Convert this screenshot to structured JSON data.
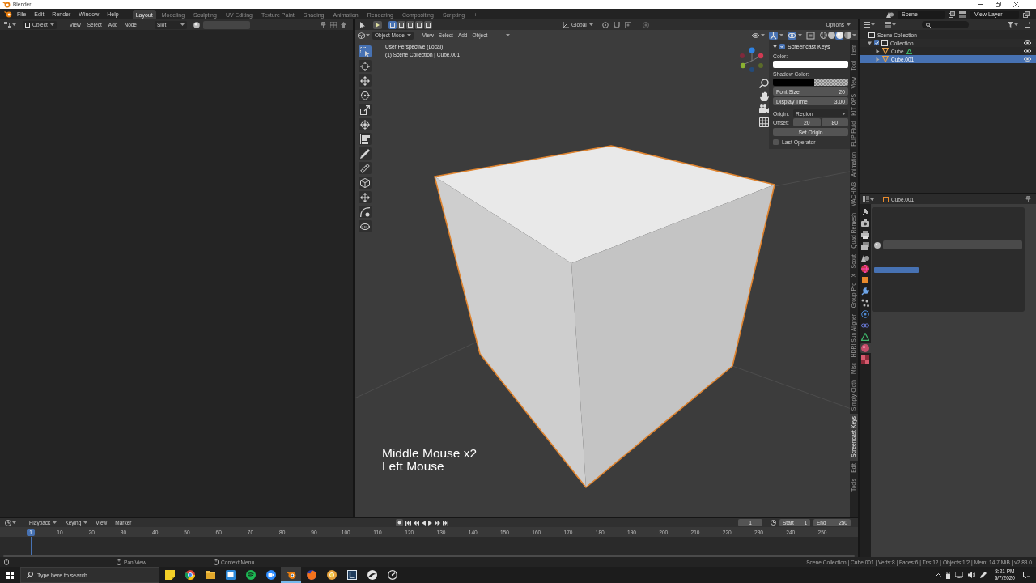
{
  "window": {
    "title": "Blender"
  },
  "menu": [
    "File",
    "Edit",
    "Render",
    "Window",
    "Help"
  ],
  "workspaces": [
    {
      "label": "Layout",
      "selected": true
    },
    {
      "label": "Modeling",
      "selected": false
    },
    {
      "label": "Sculpting",
      "selected": false
    },
    {
      "label": "UV Editing",
      "selected": false
    },
    {
      "label": "Texture Paint",
      "selected": false
    },
    {
      "label": "Shading",
      "selected": false
    },
    {
      "label": "Animation",
      "selected": false
    },
    {
      "label": "Rendering",
      "selected": false
    },
    {
      "label": "Compositing",
      "selected": false
    },
    {
      "label": "Scripting",
      "selected": false
    }
  ],
  "add_workspace": "+",
  "scene": {
    "scene": "Scene",
    "view_layer": "View Layer"
  },
  "node_editor": {
    "object_menu": "Object",
    "menus": [
      "View",
      "Select",
      "Add",
      "Node"
    ],
    "slot": "Slot"
  },
  "viewport": {
    "select_modes": [
      {
        "selected": true
      },
      {
        "selected": false
      },
      {
        "selected": false
      },
      {
        "selected": false
      },
      {
        "selected": false
      }
    ],
    "orientation": "Global",
    "options": "Options",
    "mode": "Object Mode",
    "menus": [
      "View",
      "Select",
      "Add",
      "Object"
    ],
    "toggles": [
      {
        "kind": "gizmo",
        "on": true
      },
      {
        "kind": "overlay",
        "on": true
      },
      {
        "kind": "xray",
        "on": false
      }
    ],
    "shading": [
      {
        "kind": "wireframe",
        "selected": false
      },
      {
        "kind": "solid",
        "selected": false
      },
      {
        "kind": "material",
        "selected": true
      },
      {
        "kind": "rendered",
        "selected": false
      }
    ],
    "tools": [
      {
        "kind": "select",
        "selected": true
      },
      {
        "kind": "cursor",
        "selected": false
      },
      {
        "kind": "move",
        "selected": false
      },
      {
        "kind": "rotate",
        "selected": false
      },
      {
        "kind": "scale",
        "selected": false
      },
      {
        "kind": "transform",
        "selected": false
      },
      {
        "kind": "align",
        "selected": false
      },
      {
        "kind": "annotate",
        "selected": false
      },
      {
        "kind": "measure",
        "selected": false
      },
      {
        "kind": "cube",
        "selected": false
      },
      {
        "kind": "move",
        "selected": false
      },
      {
        "kind": "bend",
        "selected": false
      },
      {
        "kind": "loop",
        "selected": false
      }
    ],
    "view_name": "User Perspective (Local)",
    "collection_info": "(1) Scene Collection | Cube.001",
    "keys": [
      "Middle Mouse x2",
      "Left Mouse"
    ]
  },
  "sidebar": {
    "panel": {
      "title": "Screencast Keys",
      "expanded": true,
      "enabled": true
    },
    "rows": [
      {
        "kind": "color",
        "label": "Color:",
        "color": "#ffffff"
      },
      {
        "kind": "color",
        "label": "Shadow Color:",
        "color": "#000000",
        "alpha": true
      },
      {
        "kind": "number",
        "label": "Font Size",
        "value": "20"
      },
      {
        "kind": "number",
        "label": "Display Time",
        "value": "3.00"
      },
      {
        "kind": "enum",
        "label": "Origin:",
        "value": "Region"
      },
      {
        "kind": "vector",
        "label": "Offset:",
        "values": [
          "20",
          "80"
        ]
      },
      {
        "kind": "button",
        "label": "Set Origin"
      },
      {
        "kind": "checkbox",
        "label": "Last Operator",
        "checked": false
      }
    ],
    "tabs": [
      {
        "label": "Item",
        "selected": false
      },
      {
        "label": "Tool",
        "selected": false
      },
      {
        "label": "View",
        "selected": false
      },
      {
        "label": "KIT OPS",
        "selected": false
      },
      {
        "label": "FLIP Fluid",
        "selected": false
      },
      {
        "label": "Animation",
        "selected": false
      },
      {
        "label": "MACHIN3",
        "selected": false
      },
      {
        "label": "Quad Remesh",
        "selected": false
      },
      {
        "label": "Scout",
        "selected": false
      },
      {
        "label": "X",
        "selected": false
      },
      {
        "label": "Group Pro",
        "selected": false
      },
      {
        "label": "HDRI Sun Aligner",
        "selected": false
      },
      {
        "label": "Misc",
        "selected": false
      },
      {
        "label": "Simply Cloth",
        "selected": false
      },
      {
        "label": "Screencast Keys",
        "selected": true
      },
      {
        "label": "Edit",
        "selected": false
      },
      {
        "label": "Tools",
        "selected": false
      }
    ]
  },
  "outliner": {
    "tree": [
      {
        "label": "Scene Collection",
        "kind": "scene",
        "selected": false,
        "children": [
          {
            "label": "Collection",
            "kind": "collection",
            "selected": false,
            "expanded": true,
            "checked": true,
            "visible": true,
            "children": [
              {
                "label": "Cube",
                "kind": "mesh",
                "selected": false,
                "expanded": false,
                "visible": true,
                "has_data": true
              },
              {
                "label": "Cube.001",
                "kind": "mesh",
                "selected": true,
                "expanded": false,
                "visible": true
              }
            ]
          }
        ]
      }
    ]
  },
  "properties": {
    "object": "Cube.001",
    "tabs": [
      {
        "kind": "tool",
        "selected": false
      },
      {
        "kind": "render",
        "selected": false
      },
      {
        "kind": "output",
        "selected": false
      },
      {
        "kind": "view_layer",
        "selected": false
      },
      {
        "kind": "scene",
        "selected": false
      },
      {
        "kind": "world",
        "selected": false
      },
      {
        "kind": "object",
        "selected": false
      },
      {
        "kind": "modifiers",
        "selected": false
      },
      {
        "kind": "particles",
        "selected": false
      },
      {
        "kind": "physics",
        "selected": false
      },
      {
        "kind": "constraints",
        "selected": false
      },
      {
        "kind": "data",
        "selected": false
      },
      {
        "kind": "material",
        "selected": true
      },
      {
        "kind": "texture",
        "selected": false
      }
    ]
  },
  "timeline": {
    "menus": [
      {
        "label": "Playback",
        "dropdown": true
      },
      {
        "label": "Keying",
        "dropdown": true
      },
      {
        "label": "View",
        "dropdown": false
      },
      {
        "label": "Marker",
        "dropdown": false
      }
    ],
    "current_frame": "1",
    "start": {
      "label": "Start",
      "value": "1"
    },
    "end": {
      "label": "End",
      "value": "250"
    },
    "frame_marker": "1",
    "ticks": [
      "10",
      "20",
      "30",
      "40",
      "50",
      "60",
      "70",
      "80",
      "90",
      "100",
      "110",
      "120",
      "130",
      "140",
      "150",
      "160",
      "170",
      "180",
      "190",
      "200",
      "210",
      "220",
      "230",
      "240",
      "250"
    ]
  },
  "status_bar": {
    "hints": [
      {
        "label": "Pan View"
      },
      {
        "label": "Context Menu"
      }
    ],
    "stats": "Scene Collection | Cube.001 | Verts:8 | Faces:6 | Tris:12 | Objects:1/2 | Mem: 14.7 MiB | v2.83.0"
  },
  "taskbar": {
    "search": {
      "placeholder": "Type here to search"
    },
    "apps": [
      {
        "kind": "note",
        "selected": false
      },
      {
        "kind": "ring",
        "selected": false
      },
      {
        "kind": "folder",
        "selected": false
      },
      {
        "kind": "window",
        "selected": false
      },
      {
        "kind": "wave",
        "selected": false
      },
      {
        "kind": "camera",
        "selected": false
      },
      {
        "kind": "orbit",
        "selected": true
      },
      {
        "kind": "flame",
        "selected": false
      },
      {
        "kind": "dotring",
        "selected": false
      },
      {
        "kind": "frame",
        "selected": false
      },
      {
        "kind": "swoosh",
        "selected": false
      },
      {
        "kind": "gauge",
        "selected": false
      }
    ],
    "time": "8:21 PM",
    "date": "5/7/2020"
  }
}
